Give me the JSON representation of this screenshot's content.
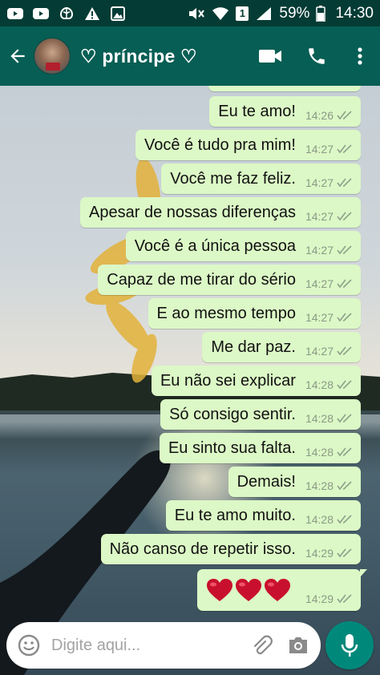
{
  "status_bar": {
    "battery_percent": "59%",
    "time": "14:30",
    "sim_label": "1",
    "left_icons": [
      "youtube-icon",
      "youtube-icon",
      "brain-icon",
      "warning-icon",
      "gallery-icon"
    ],
    "right_icons": [
      "mute-icon",
      "wifi-icon",
      "signal-icon",
      "battery-icon"
    ]
  },
  "header": {
    "contact_name": "♡ príncipe ♡",
    "icons": [
      "back-arrow-icon",
      "video-call-icon",
      "phone-icon",
      "more-vert-icon"
    ]
  },
  "messages": [
    {
      "text": "Eu te amo!",
      "time": "14:26",
      "status": "read"
    },
    {
      "text": "Você é tudo pra mim!",
      "time": "14:27",
      "status": "read"
    },
    {
      "text": "Você me faz feliz.",
      "time": "14:27",
      "status": "read"
    },
    {
      "text": "Apesar de nossas diferenças",
      "time": "14:27",
      "status": "read"
    },
    {
      "text": "Você é a única pessoa",
      "time": "14:27",
      "status": "read"
    },
    {
      "text": "Capaz de me tirar do sério",
      "time": "14:27",
      "status": "read"
    },
    {
      "text": "E ao mesmo tempo",
      "time": "14:27",
      "status": "read"
    },
    {
      "text": "Me dar paz.",
      "time": "14:27",
      "status": "read"
    },
    {
      "text": "Eu não sei explicar",
      "time": "14:28",
      "status": "read"
    },
    {
      "text": "Só consigo sentir.",
      "time": "14:28",
      "status": "read"
    },
    {
      "text": "Eu sinto sua falta.",
      "time": "14:28",
      "status": "read"
    },
    {
      "text": "Demais!",
      "time": "14:28",
      "status": "read"
    },
    {
      "text": "Eu te amo muito.",
      "time": "14:28",
      "status": "read"
    },
    {
      "text": "Não canso de repetir isso.",
      "time": "14:29",
      "status": "read"
    },
    {
      "text": "",
      "emoji": [
        "heart",
        "heart",
        "heart"
      ],
      "time": "14:29",
      "status": "read"
    }
  ],
  "input": {
    "placeholder": "Digite aqui...",
    "icons": [
      "emoji-icon",
      "attach-icon",
      "camera-icon",
      "mic-icon"
    ]
  },
  "colors": {
    "header": "#075e54",
    "status_bar": "#043c35",
    "outgoing_bubble": "#dcf8c6",
    "mic_button": "#00897b",
    "ticks": "#8fa08b"
  }
}
